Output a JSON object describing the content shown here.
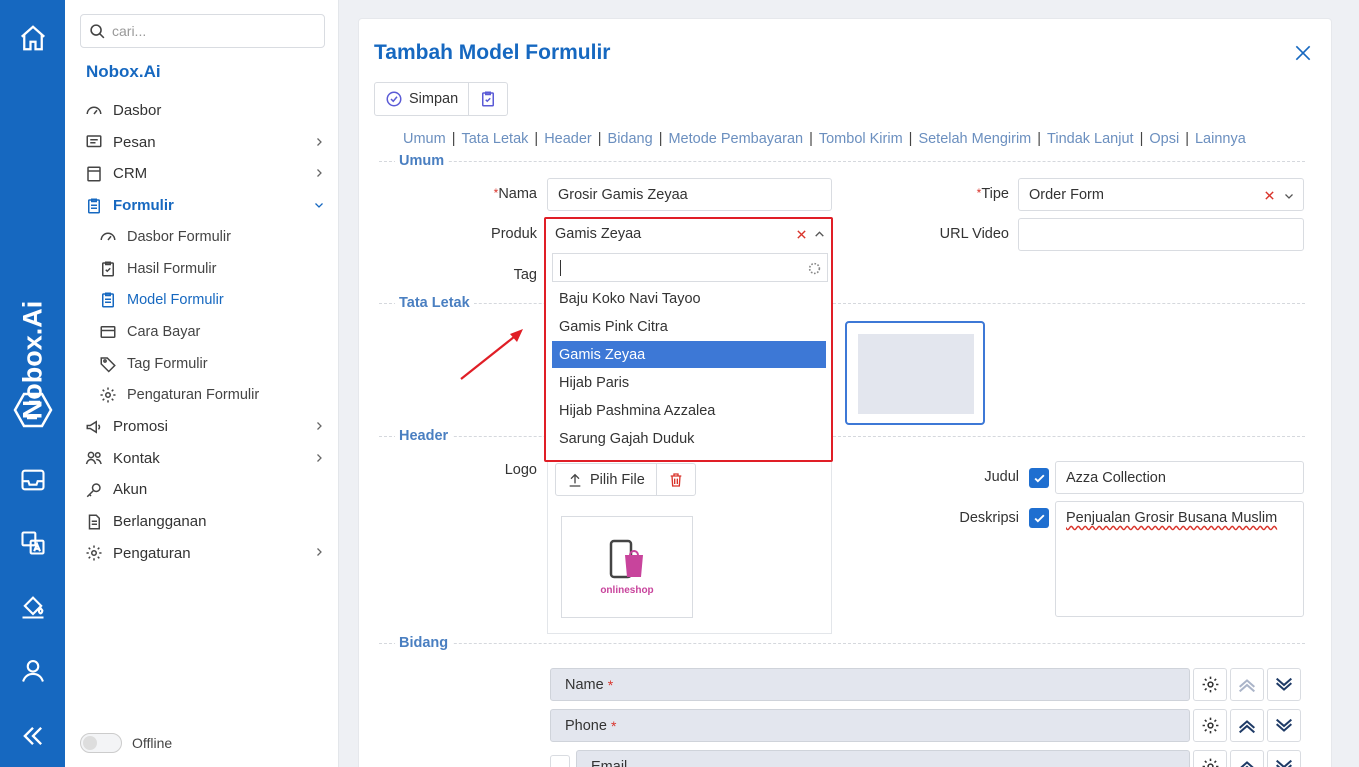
{
  "brand": "Nobox.Ai",
  "search": {
    "placeholder": "cari..."
  },
  "org_name": "Nobox.Ai",
  "menu": [
    {
      "label": "Dasbor",
      "icon": "dashboard-icon"
    },
    {
      "label": "Pesan",
      "icon": "message-icon"
    },
    {
      "label": "CRM",
      "icon": "crm-icon"
    },
    {
      "label": "Formulir",
      "icon": "form-icon"
    },
    {
      "label": "Dasbor Formulir",
      "icon": "dashboard-icon"
    },
    {
      "label": "Hasil Formulir",
      "icon": "clipboard-check-icon"
    },
    {
      "label": "Model Formulir",
      "icon": "form-icon"
    },
    {
      "label": "Cara Bayar",
      "icon": "card-icon"
    },
    {
      "label": "Tag Formulir",
      "icon": "tag-icon"
    },
    {
      "label": "Pengaturan Formulir",
      "icon": "gear-icon"
    },
    {
      "label": "Promosi",
      "icon": "megaphone-icon"
    },
    {
      "label": "Kontak",
      "icon": "contacts-icon"
    },
    {
      "label": "Akun",
      "icon": "key-icon"
    },
    {
      "label": "Berlangganan",
      "icon": "document-icon"
    },
    {
      "label": "Pengaturan",
      "icon": "gear-icon"
    }
  ],
  "status": {
    "offline_label": "Offline"
  },
  "panel": {
    "title": "Tambah Model Formulir",
    "save_label": "Simpan",
    "tabs": [
      "Umum",
      "Tata Letak",
      "Header",
      "Bidang",
      "Metode Pembayaran",
      "Tombol Kirim",
      "Setelah Mengirim",
      "Tindak Lanjut",
      "Opsi",
      "Lainnya"
    ],
    "sections": {
      "umum": "Umum",
      "tata_letak": "Tata Letak",
      "header": "Header",
      "bidang": "Bidang"
    },
    "form": {
      "nama_label": "Nama",
      "nama_value": "Grosir Gamis Zeyaa",
      "tipe_label": "Tipe",
      "tipe_value": "Order Form",
      "produk_label": "Produk",
      "produk_value": "Gamis Zeyaa",
      "url_video_label": "URL Video",
      "url_video_value": "",
      "tag_label": "Tag"
    },
    "dropdown": {
      "options": [
        "Baju Koko Navi Tayoo",
        "Gamis Pink Citra",
        "Gamis Zeyaa",
        "Hijab Paris",
        "Hijab Pashmina Azzalea",
        "Sarung Gajah Duduk"
      ],
      "selected": "Gamis Zeyaa"
    },
    "header": {
      "logo_label": "Logo",
      "pilih_file_label": "Pilih File",
      "logo_text": "onlineshop",
      "judul_label": "Judul",
      "judul_value": "Azza Collection",
      "deskripsi_label": "Deskripsi",
      "deskripsi_value": "Penjualan Grosir Busana Muslim"
    },
    "fields": [
      {
        "label": "Name",
        "required": "*"
      },
      {
        "label": "Phone",
        "required": "*"
      },
      {
        "label": "Email",
        "required": ""
      }
    ]
  },
  "colors": {
    "accent": "#1668c0",
    "highlight": "#3d78d6",
    "annotation": "#e01e26"
  }
}
